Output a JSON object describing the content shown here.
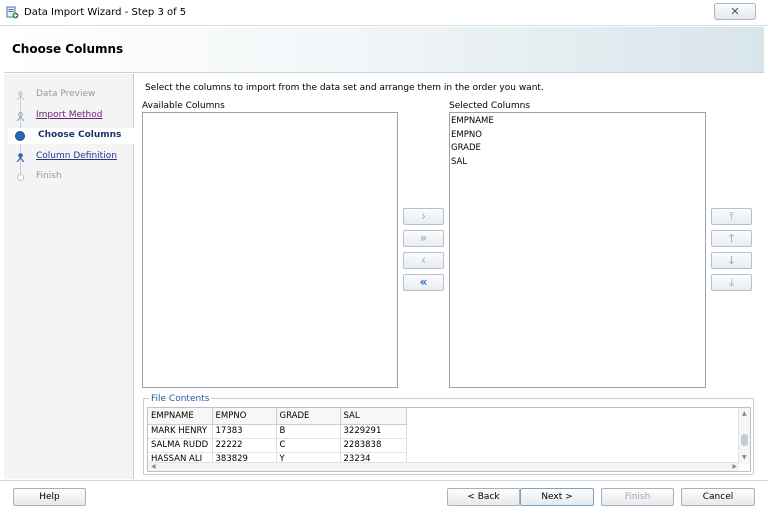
{
  "window": {
    "title": "Data Import Wizard - Step 3 of 5",
    "close_glyph": "✕"
  },
  "header": {
    "title": "Choose Columns"
  },
  "nav": {
    "items": [
      {
        "label": "Data Preview",
        "state": "disabled"
      },
      {
        "label": "Import Method",
        "state": "visited"
      },
      {
        "label": "Choose Columns",
        "state": "current"
      },
      {
        "label": "Column Definition",
        "state": "link"
      },
      {
        "label": "Finish",
        "state": "disabled"
      }
    ]
  },
  "main": {
    "instruction": "Select the columns to import from the data set and arrange them in the order you want.",
    "available_label": "Available Columns",
    "selected_label": "Selected Columns",
    "available_columns": [],
    "selected_columns": [
      "EMPNAME",
      "EMPNO",
      "GRADE",
      "SAL"
    ]
  },
  "move_buttons": {
    "add": "›",
    "add_all": "»",
    "remove": "‹",
    "remove_all": "«"
  },
  "order_buttons": {
    "top": "⤒",
    "up": "↑",
    "down": "↓",
    "bottom": "⤓"
  },
  "file_contents": {
    "title": "File Contents",
    "headers": [
      "EMPNAME",
      "EMPNO",
      "GRADE",
      "SAL"
    ],
    "rows": [
      [
        "MARK HENRY",
        "17383",
        "B",
        "3229291"
      ],
      [
        "SALMA RUDD",
        "22222",
        "C",
        "2283838"
      ],
      [
        "HASSAN ALI",
        "383829",
        "Y",
        "23234"
      ]
    ]
  },
  "footer": {
    "help": "Help",
    "back": "< Back",
    "next": "Next >",
    "finish": "Finish",
    "cancel": "Cancel"
  },
  "colors": {
    "accent": "#2c64b8",
    "current_step_text": "#1e3469",
    "visited_link": "#6a1f78",
    "link": "#1f3c8a",
    "group_title": "#2b5a9e"
  }
}
